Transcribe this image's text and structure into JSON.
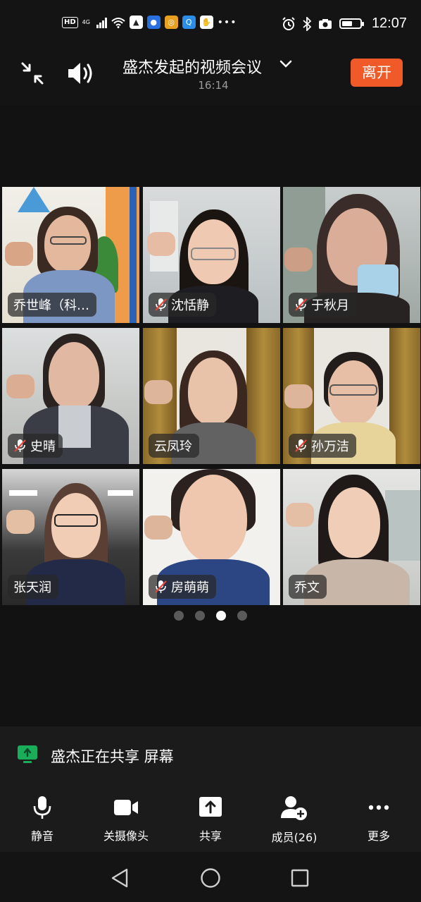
{
  "status_bar": {
    "badge_hd": "HD",
    "network": "4G",
    "time": "12:07",
    "icons": [
      "signal-icon",
      "wifi-icon",
      "app-icon",
      "app-icon",
      "app-icon",
      "app-icon",
      "app-icon",
      "more-icon",
      "alarm-icon",
      "bluetooth-icon",
      "camera-icon",
      "battery-icon"
    ]
  },
  "header": {
    "title": "盛杰发起的视频会议",
    "duration": "16:14",
    "leave_label": "离开"
  },
  "participants": [
    {
      "name": "乔世峰（科…",
      "muted": false
    },
    {
      "name": "沈恬静",
      "muted": true
    },
    {
      "name": "于秋月",
      "muted": true
    },
    {
      "name": "史晴",
      "muted": true
    },
    {
      "name": "云凤玲",
      "muted": false
    },
    {
      "name": "孙万洁",
      "muted": true
    },
    {
      "name": "张天润",
      "muted": false
    },
    {
      "name": "房萌萌",
      "muted": true
    },
    {
      "name": "乔文",
      "muted": false
    }
  ],
  "pagination": {
    "pages": 4,
    "current": 3
  },
  "share_banner": {
    "text": "盛杰正在共享 屏幕"
  },
  "toolbar": {
    "mute_label": "静音",
    "camera_label": "关摄像头",
    "share_label": "共享",
    "members_label": "成员(26)",
    "more_label": "更多"
  },
  "colors": {
    "background": "#121212",
    "leave_button": "#f05a28",
    "share_icon": "#1aad5a"
  }
}
